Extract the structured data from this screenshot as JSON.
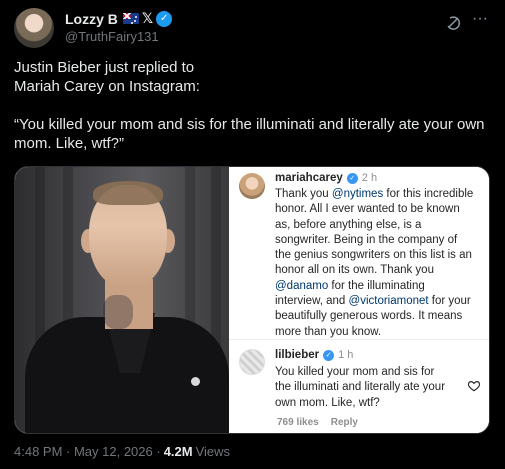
{
  "author": {
    "display_name": "Lozzy B",
    "x_glyph": "𝕏",
    "handle": "@TruthFairy131"
  },
  "icons": {
    "verified": "verified-badge-icon",
    "grok": "grok-icon",
    "more": "more-options-icon",
    "heart": "heart-icon",
    "flag": "australia-flag-icon"
  },
  "tweet": {
    "line1": "Justin Bieber just replied to",
    "line2": "Mariah Carey on Instagram:",
    "quote_line1": "“You killed your mom and sis for the illuminati and literally ate your own",
    "quote_line2": "mom. Like, wtf?”"
  },
  "media": {
    "instagram": {
      "comment1": {
        "user": "mariahcarey",
        "time": "2 h",
        "lines": [
          [
            "Thank you ",
            "@nytimes",
            " for this incredible"
          ],
          [
            "honor. All I ever wanted to be known"
          ],
          [
            "as, before anything else, is a"
          ],
          [
            "songwriter. Being in the company of"
          ],
          [
            "the genius songwriters on this list is an"
          ],
          [
            "honor all on its own. Thank you"
          ],
          [
            "@danamo",
            " for the illuminating"
          ],
          [
            "interview, and ",
            "@victoriamonet",
            " for your"
          ],
          [
            "beautifully generous words. It means"
          ],
          [
            "more than you know."
          ]
        ]
      },
      "comment2": {
        "user": "lilbieber",
        "time": "1 h",
        "line1": "You killed your mom and sis for",
        "line2": "the illuminati and literally ate your",
        "line3": "own mom. Like, wtf?",
        "likes": "769 likes",
        "reply": "Reply"
      }
    }
  },
  "footer": {
    "timestamp": "4:48 PM · May 12, 2026 ·",
    "views_count": "4.2M",
    "views_label": "Views"
  },
  "colors": {
    "background": "#000000",
    "text_primary": "#e7e9ea",
    "text_secondary": "#71767b",
    "verified_blue": "#1d9bf0",
    "ig_mention": "#00376b"
  }
}
